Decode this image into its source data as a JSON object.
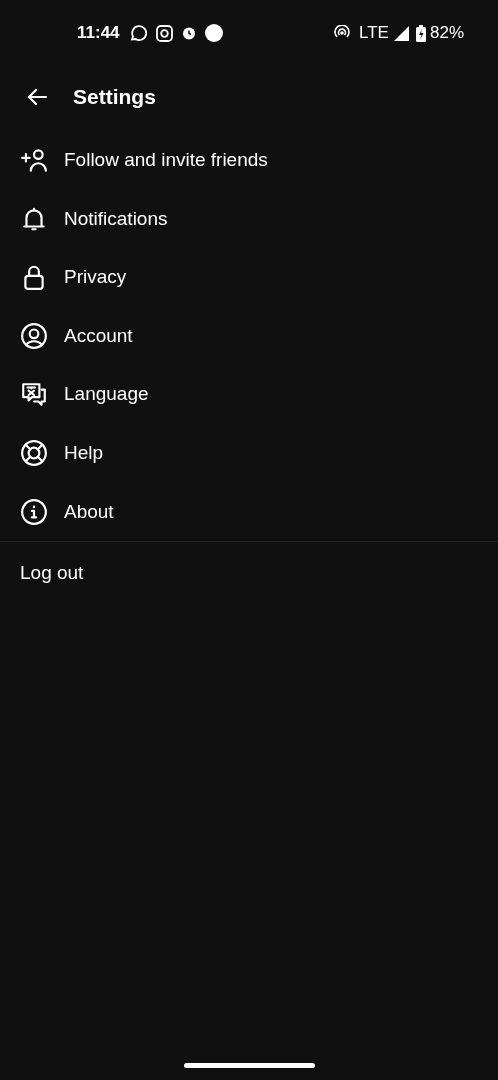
{
  "status_bar": {
    "time": "11:44",
    "network": "LTE",
    "battery": "82%"
  },
  "header": {
    "title": "Settings"
  },
  "items": [
    {
      "kind": "follow",
      "label": "Follow and invite friends"
    },
    {
      "kind": "notifications",
      "label": "Notifications"
    },
    {
      "kind": "privacy",
      "label": "Privacy"
    },
    {
      "kind": "account",
      "label": "Account"
    },
    {
      "kind": "language",
      "label": "Language"
    },
    {
      "kind": "help",
      "label": "Help"
    },
    {
      "kind": "about",
      "label": "About"
    }
  ],
  "logout": "Log out"
}
